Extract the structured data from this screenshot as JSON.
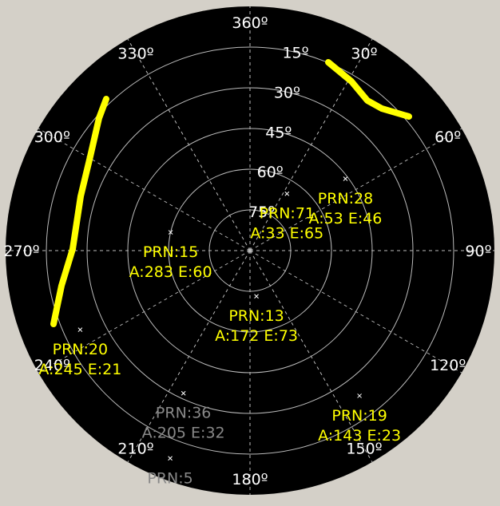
{
  "skyplot": {
    "azimuth_labels": [
      {
        "azimuth": 0,
        "label": "360º"
      },
      {
        "azimuth": 30,
        "label": "30º"
      },
      {
        "azimuth": 60,
        "label": "60º"
      },
      {
        "azimuth": 90,
        "label": "90º"
      },
      {
        "azimuth": 120,
        "label": "120º"
      },
      {
        "azimuth": 150,
        "label": "150º"
      },
      {
        "azimuth": 180,
        "label": "180º"
      },
      {
        "azimuth": 210,
        "label": "210º"
      },
      {
        "azimuth": 240,
        "label": "240º"
      },
      {
        "azimuth": 270,
        "label": "270º"
      },
      {
        "azimuth": 300,
        "label": "300º"
      },
      {
        "azimuth": 330,
        "label": "330º"
      }
    ],
    "elevation_labels": [
      {
        "elevation": 15,
        "label": "15º"
      },
      {
        "elevation": 30,
        "label": "30º"
      },
      {
        "elevation": 45,
        "label": "45º"
      },
      {
        "elevation": 60,
        "label": "60º"
      },
      {
        "elevation": 75,
        "label": "75º"
      }
    ],
    "satellites": [
      {
        "prn_label": "PRN:71",
        "pos_label": "A:33 E:65",
        "azimuth": 33,
        "elevation": 65,
        "active": true
      },
      {
        "prn_label": "PRN:28",
        "pos_label": "A:53 E:46",
        "azimuth": 53,
        "elevation": 46,
        "active": true
      },
      {
        "prn_label": "PRN:15",
        "pos_label": "A:283 E:60",
        "azimuth": 283,
        "elevation": 60,
        "active": true
      },
      {
        "prn_label": "PRN:13",
        "pos_label": "A:172 E:73",
        "azimuth": 172,
        "elevation": 73,
        "active": true
      },
      {
        "prn_label": "PRN:20",
        "pos_label": "A:245 E:21",
        "azimuth": 245,
        "elevation": 21,
        "active": true
      },
      {
        "prn_label": "PRN:19",
        "pos_label": "A:143 E:23",
        "azimuth": 143,
        "elevation": 23,
        "active": true
      },
      {
        "prn_label": "PRN:36",
        "pos_label": "A:205 E:32",
        "azimuth": 205,
        "elevation": 32,
        "active": false
      },
      {
        "prn_label": "PRN:5",
        "pos_label": "",
        "azimuth": 201,
        "elevation": 8,
        "active": false
      }
    ],
    "colors": {
      "background": "#000000",
      "grid": "#bbbbbb",
      "active": "#ffff00",
      "inactive": "#888888",
      "marker": "#ffffff",
      "frame": "#d4d0c8"
    }
  }
}
